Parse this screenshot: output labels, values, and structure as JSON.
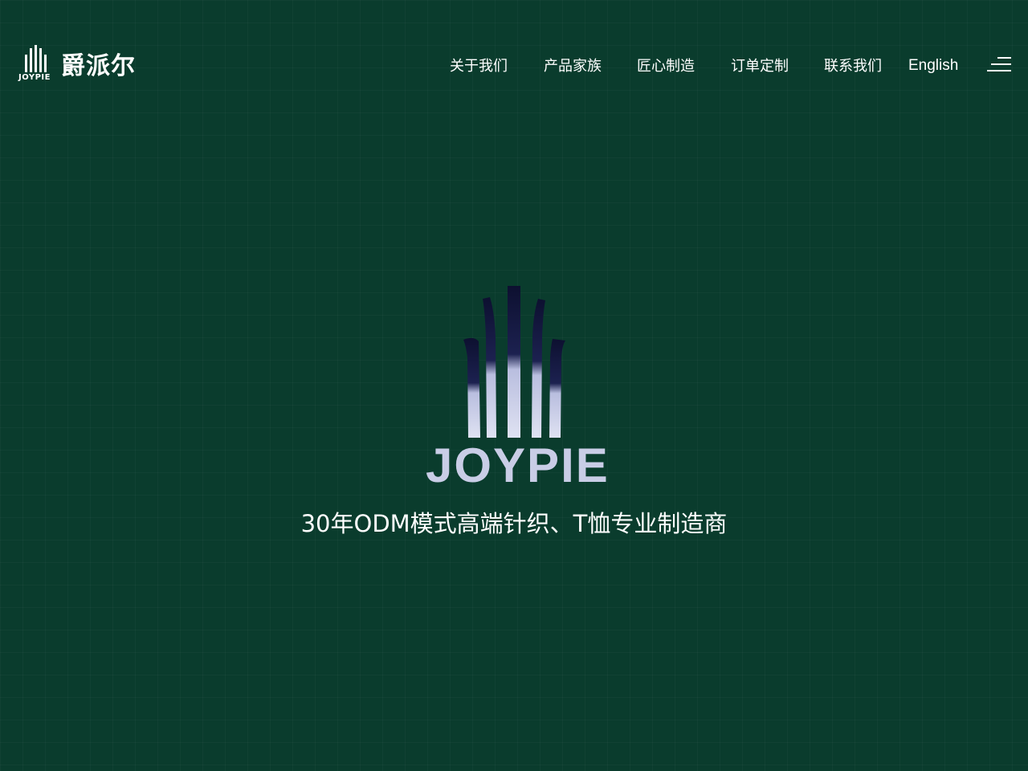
{
  "brand": {
    "mark_text": "JOYPIE",
    "name_cn": "爵派尔"
  },
  "nav": {
    "items": [
      {
        "label": "关于我们"
      },
      {
        "label": "产品家族"
      },
      {
        "label": "匠心制造"
      },
      {
        "label": "订单定制"
      },
      {
        "label": "联系我们"
      }
    ],
    "language": "English",
    "menu_icon": "hamburger-menu-icon"
  },
  "hero": {
    "logo_text": "JOYPIE",
    "tagline": "30年ODM模式高端针织、T恤专业制造商"
  },
  "colors": {
    "background": "#0a3c2d",
    "text": "#ffffff",
    "logo_light": "#c9cde6",
    "logo_dark": "#0d1030"
  }
}
